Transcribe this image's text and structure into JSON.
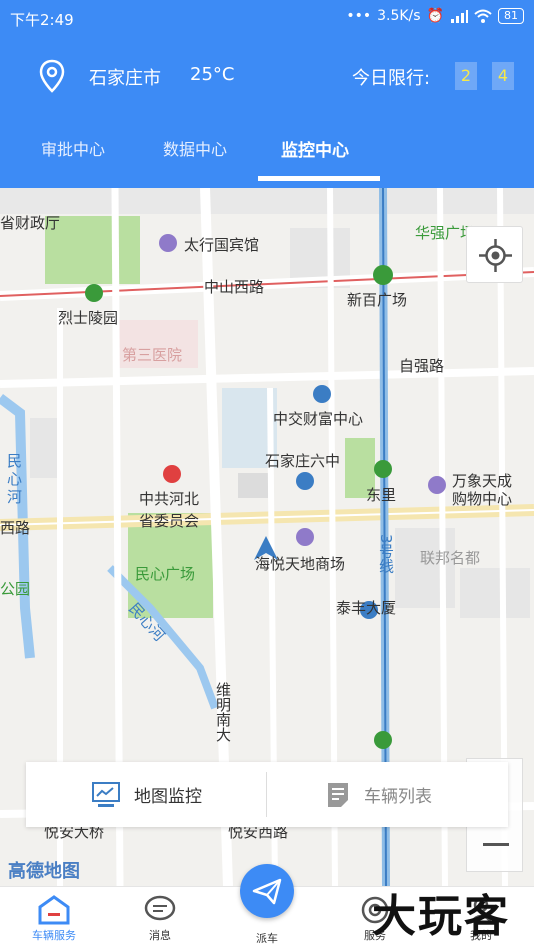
{
  "status": {
    "time": "下午2:49",
    "net_speed": "3.5K/s",
    "battery": "81"
  },
  "header": {
    "city": "石家庄市",
    "temperature": "25°C",
    "limit_label": "今日限行:",
    "limit_numbers": [
      "2",
      "4"
    ]
  },
  "tabs": [
    {
      "label": "审批中心",
      "active": false
    },
    {
      "label": "数据中心",
      "active": false
    },
    {
      "label": "监控中心",
      "active": true
    }
  ],
  "map": {
    "labels": {
      "province_finance": "省财政厅",
      "taihang_hotel": "太行国宾馆",
      "huaqiang": "华强广场",
      "zhongshan_west": "中山西路",
      "xinbai_plaza": "新百广场",
      "lieshi_cemetery": "烈士陵园",
      "third_hospital": "第三医院",
      "ziqiang_road": "自强路",
      "zhongjiao_center": "中交财富中心",
      "sjz_no6_middle": "石家庄六中",
      "dongli": "东里",
      "wanxiang_1": "万象天成",
      "wanxiang_2": "购物中心",
      "cpc_hebei_1": "中共河北",
      "cpc_hebei_2": "省委员会",
      "xi_road": "西路",
      "minxin_river_left_1": "民",
      "minxin_river_left_2": "心",
      "minxin_river_left_3": "河",
      "haiyue": "海悦天地商场",
      "metro_line3": "3号线",
      "lianbang": "联邦名都",
      "minxin_plaza": "民心广场",
      "park": "公园",
      "minxin_river": "民心河",
      "taifeng": "泰丰大厦",
      "weiming_south": "维明南大",
      "huaian_bridge": "悦安大桥",
      "huaian_west": "悦安西路"
    },
    "amap_logo": "高德地图"
  },
  "panel": {
    "map_monitor": "地图监控",
    "vehicle_list": "车辆列表"
  },
  "bottom_nav": {
    "vehicle_service": "车辆服务",
    "messages": "消息",
    "dispatch": "派车",
    "service": "服务",
    "mine": "我的"
  },
  "watermark": "大玩客",
  "colors": {
    "primary": "#3d8bf5",
    "limit_number": "#f6e84a",
    "park_green": "#b9dfa0",
    "water": "#9cc8ef"
  }
}
